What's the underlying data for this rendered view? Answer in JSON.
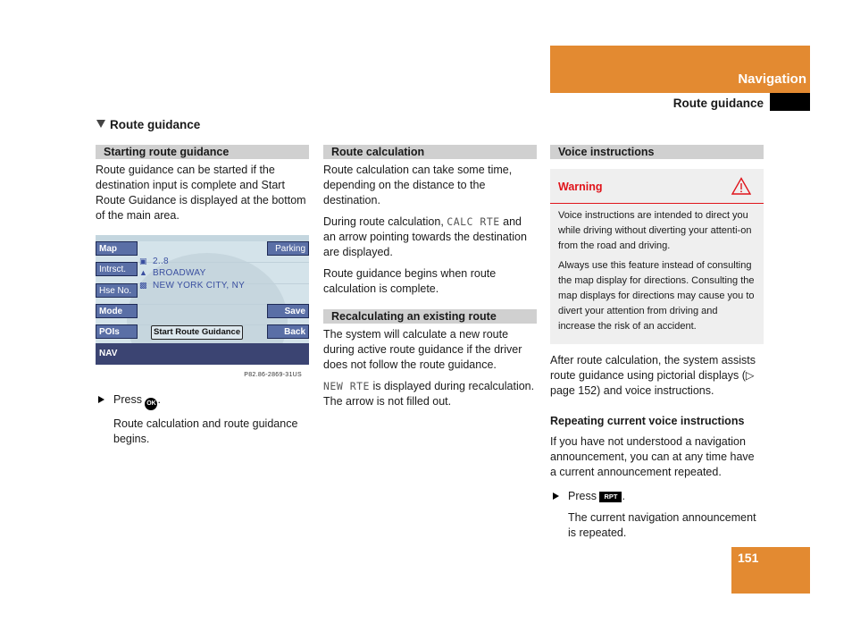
{
  "header": {
    "chapter": "Navigation",
    "section": "Route guidance"
  },
  "title": "Route guidance",
  "col1": {
    "heading": "Starting route guidance",
    "intro": "Route guidance can be started if the destination input is complete and Start Route Guidance is displayed at the bottom of the main area.",
    "screen": {
      "left_buttons": [
        "Map",
        "Intrsct.",
        "Hse No.",
        "Mode",
        "POIs"
      ],
      "right_buttons": [
        "Parking",
        "Save",
        "Back"
      ],
      "rows": [
        {
          "icon": "house-number-icon",
          "text": "2..8"
        },
        {
          "icon": "road-icon",
          "text": "BROADWAY"
        },
        {
          "icon": "city-icon",
          "text": "NEW YORK CITY, NY"
        }
      ],
      "start_button": "Start Route Guidance",
      "status_bar": "NAV",
      "image_code": "P82.86-2869-31US"
    },
    "step_press": "Press",
    "step_button": "OK",
    "step_result": "Route calculation and route guidance begins."
  },
  "col2": {
    "heading1": "Route calculation",
    "p1": "Route calculation can take some time, depending on the distance to the destination.",
    "p2_before": "During route calculation, ",
    "p2_code": "CALC RTE",
    "p2_after": " and an arrow pointing towards the destination are displayed.",
    "p3": "Route guidance begins when route calculation is complete.",
    "heading2": "Recalculating an existing route",
    "p4": "The system will calculate a new route during active route guidance if the driver does not follow the route guidance.",
    "p5_code": "NEW RTE",
    "p5_after": " is displayed during recalculation. The arrow is not filled out."
  },
  "col3": {
    "heading": "Voice instructions",
    "warning": {
      "title": "Warning",
      "p1": "Voice instructions are intended to direct you while driving without diverting your attenti-on from the road and driving.",
      "p2": "Always use this feature instead of consulting the map display for directions. Consulting the map displays for directions may cause you to divert your attention from driving and increase the risk of an accident."
    },
    "p1": "After route calculation, the system assists route guidance using pictorial displays (▷ page 152) and voice instructions.",
    "subheading": "Repeating current voice instructions",
    "p2": "If you have not understood a navigation announcement, you can at any time have a current announcement repeated.",
    "step_press": "Press",
    "step_button": "RPT",
    "step_result": "The current navigation announcement is repeated."
  },
  "page_number": "151",
  "colors": {
    "accent": "#e38a31",
    "warning": "#e0141b",
    "heading_bar": "#d0d0d0"
  }
}
